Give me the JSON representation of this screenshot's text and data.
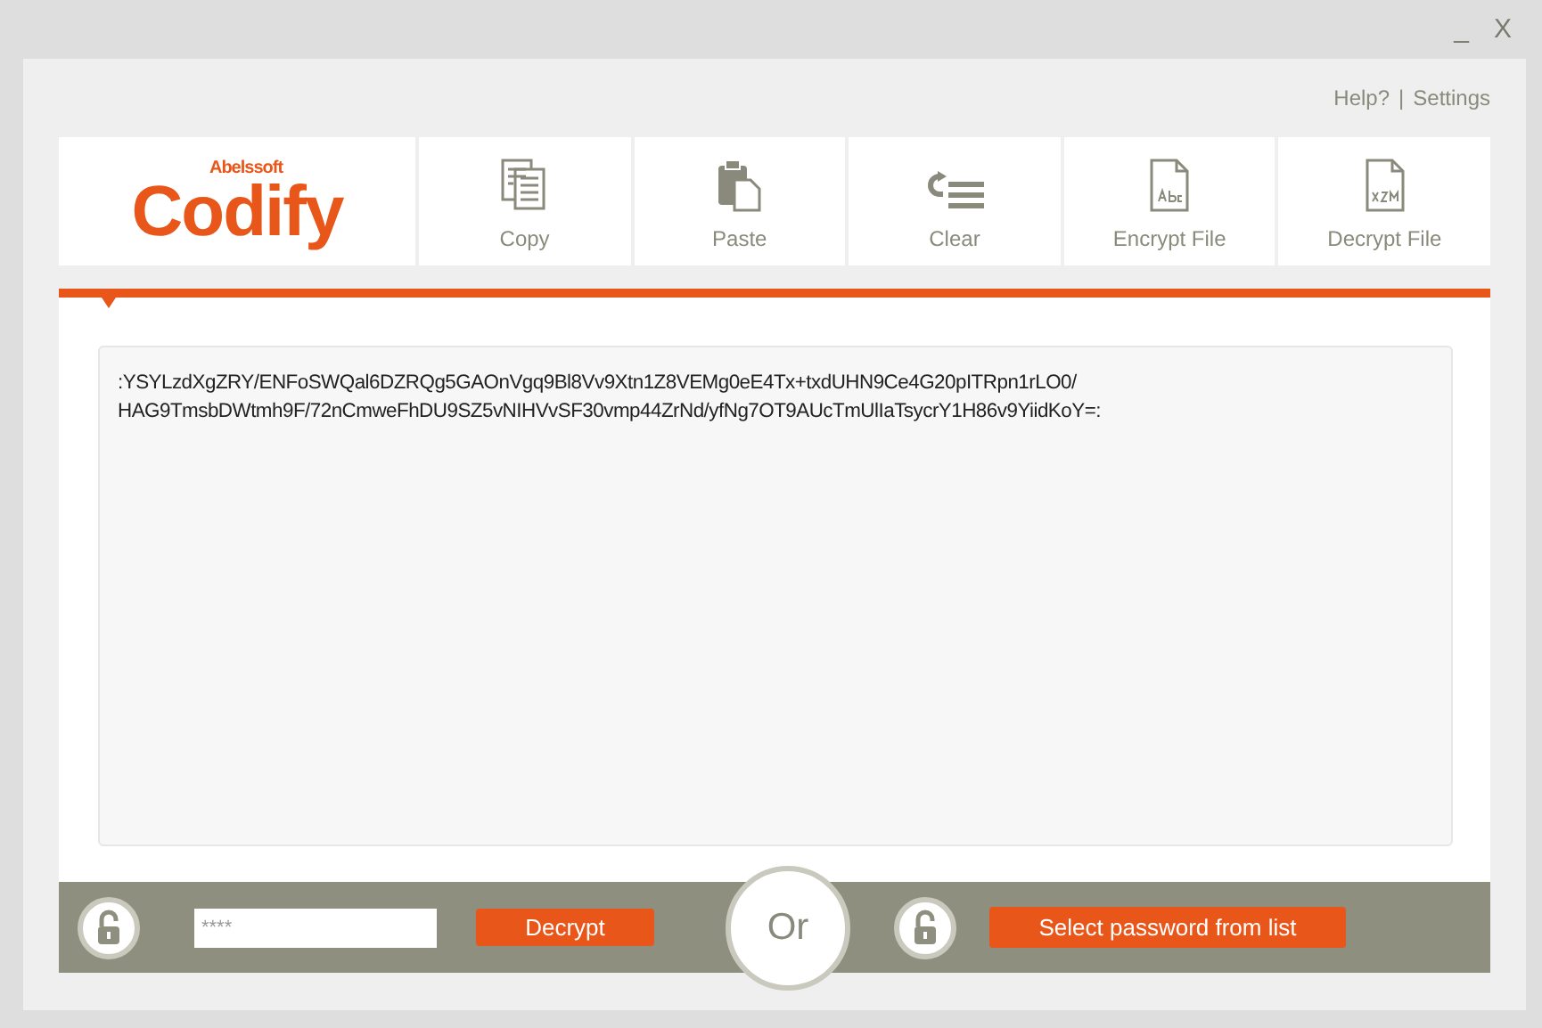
{
  "window": {
    "minimize": "_",
    "close": "X"
  },
  "header_links": [
    "Help?",
    "Settings"
  ],
  "header_separator": "|",
  "logo": {
    "brand": "Abelssoft",
    "name": "Codify"
  },
  "toolbar": [
    {
      "kind": "copy",
      "label": "Copy"
    },
    {
      "kind": "paste",
      "label": "Paste"
    },
    {
      "kind": "clear",
      "label": "Clear"
    },
    {
      "kind": "encrypt",
      "label": "Encrypt File"
    },
    {
      "kind": "decrypt",
      "label": "Decrypt File"
    }
  ],
  "text_area": {
    "value": ":YSYLzdXgZRY/ENFoSWQal6DZRQg5GAOnVgq9Bl8Vv9Xtn1Z8VEMg0eE4Tx+txdUHN9Ce4G20pITRpn1rLO0/\nHAG9TmsbDWtmh9F/72nCmweFhDU9SZ5vNIHVvSF30vmp44ZrNd/yfNg7OT9AUcTmUlIaTsycrY1H86v9YiidKoY=:"
  },
  "bottom_bar": {
    "password_value": "****",
    "decrypt_button": "Decrypt",
    "or_label": "Or",
    "select_button": "Select password from list"
  }
}
